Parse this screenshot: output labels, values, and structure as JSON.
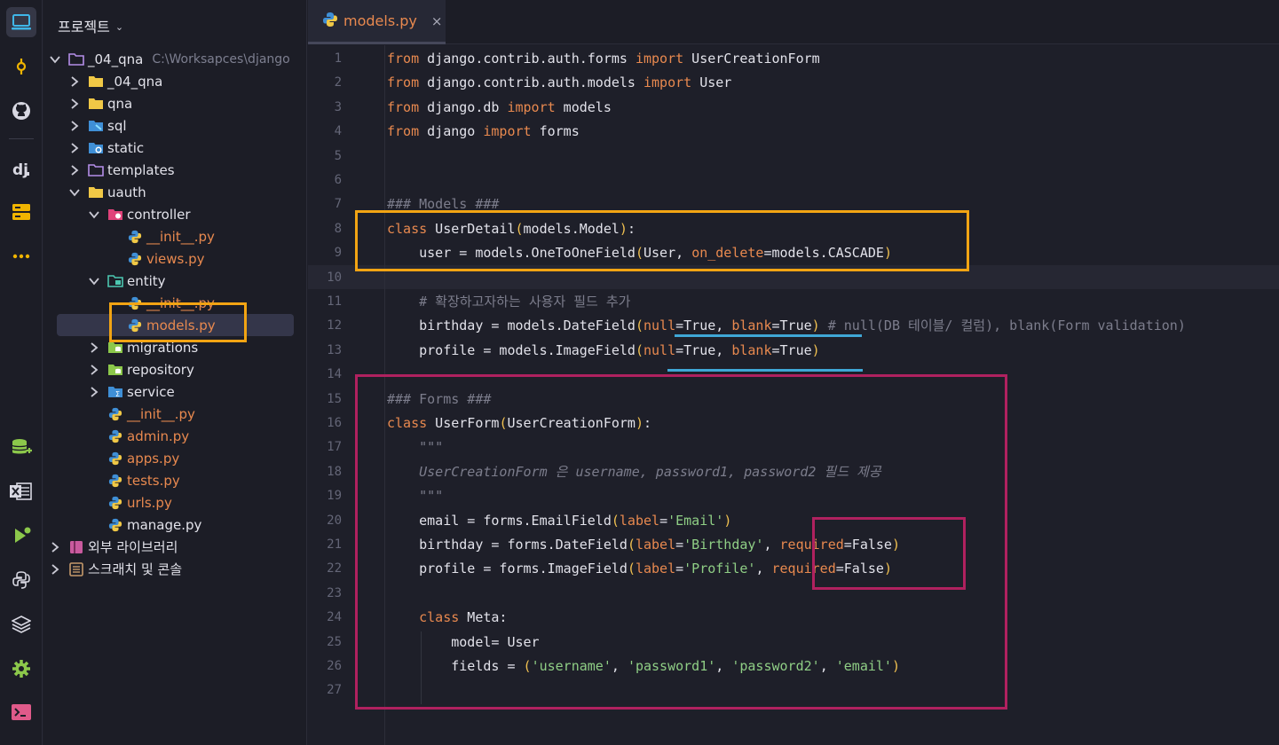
{
  "project": {
    "title": "프로젝트",
    "tree": [
      {
        "label": "_04_qna",
        "path": "C:\\Worksapces\\django",
        "type": "root-folder"
      },
      {
        "label": "_04_qna",
        "type": "folder"
      },
      {
        "label": "qna",
        "type": "folder"
      },
      {
        "label": "sql",
        "type": "folder"
      },
      {
        "label": "static",
        "type": "folder"
      },
      {
        "label": "templates",
        "type": "folder"
      },
      {
        "label": "uauth",
        "type": "folder"
      },
      {
        "label": "controller",
        "type": "folder"
      },
      {
        "label": "__init__.py",
        "type": "py"
      },
      {
        "label": "views.py",
        "type": "py"
      },
      {
        "label": "entity",
        "type": "folder"
      },
      {
        "label": "__init__.py",
        "type": "py"
      },
      {
        "label": "models.py",
        "type": "py"
      },
      {
        "label": "migrations",
        "type": "folder"
      },
      {
        "label": "repository",
        "type": "folder"
      },
      {
        "label": "service",
        "type": "folder"
      },
      {
        "label": "__init__.py",
        "type": "py"
      },
      {
        "label": "admin.py",
        "type": "py"
      },
      {
        "label": "apps.py",
        "type": "py"
      },
      {
        "label": "tests.py",
        "type": "py"
      },
      {
        "label": "urls.py",
        "type": "py"
      },
      {
        "label": "manage.py",
        "type": "py-plain"
      },
      {
        "label": "외부 라이브러리",
        "type": "library"
      },
      {
        "label": "스크래치 및 콘솔",
        "type": "scratch"
      }
    ]
  },
  "tab": {
    "label": "models.py",
    "close": "×"
  },
  "line_numbers": [
    "1",
    "2",
    "3",
    "4",
    "5",
    "6",
    "7",
    "8",
    "9",
    "10",
    "11",
    "12",
    "13",
    "14",
    "15",
    "16",
    "17",
    "18",
    "19",
    "20",
    "21",
    "22",
    "23",
    "24",
    "25",
    "26",
    "27"
  ],
  "code": {
    "l1": [
      "from",
      " django.contrib.auth.forms ",
      "import",
      " UserCreationForm"
    ],
    "l2": [
      "from",
      " django.contrib.auth.models ",
      "import",
      " User"
    ],
    "l3": [
      "from",
      " django.db ",
      "import",
      " models"
    ],
    "l4": [
      "from",
      " django ",
      "import",
      " forms"
    ],
    "l7": "### Models ###",
    "l8": [
      "class",
      " UserDetail",
      "(",
      "models.Model",
      ")",
      ":"
    ],
    "l9": [
      "    user = models.OneToOneField",
      "(",
      "User, ",
      "on_delete",
      "=models.CASCADE",
      ")"
    ],
    "l11": "    # 확장하고자하는 사용자 필드 추가",
    "l12": [
      "    birthday = models.DateField",
      "(",
      "null",
      "=True, ",
      "blank",
      "=True",
      ")",
      " # null(DB 테이블/ 컬럼), blank(Form validation)"
    ],
    "l13": [
      "    profile = models.ImageField",
      "(",
      "null",
      "=True, ",
      "blank",
      "=True",
      ")"
    ],
    "l15": "### Forms ###",
    "l16": [
      "class",
      " UserForm",
      "(",
      "UserCreationForm",
      ")",
      ":"
    ],
    "l17": "    \"\"\"",
    "l18": "    UserCreationForm 은 username, password1, password2 필드 제공",
    "l19": "    \"\"\"",
    "l20": [
      "    email = forms.EmailField",
      "(",
      "label",
      "=",
      "'Email'",
      ")"
    ],
    "l21": [
      "    birthday = forms.DateField",
      "(",
      "label",
      "=",
      "'Birthday'",
      ", ",
      "required",
      "=False",
      ")"
    ],
    "l22": [
      "    profile = forms.ImageField",
      "(",
      "label",
      "=",
      "'Profile'",
      ", ",
      "required",
      "=False",
      ")"
    ],
    "l24": [
      "    ",
      "class",
      " Meta:"
    ],
    "l25": "        model= User",
    "l26": [
      "        fields = ",
      "(",
      "'username'",
      ", ",
      "'password1'",
      ", ",
      "'password2'",
      ", ",
      "'email'",
      ")"
    ]
  },
  "annotation_colors": {
    "orange": "#f2a413",
    "magenta": "#b0215f",
    "underline": "#3fa7d6"
  }
}
